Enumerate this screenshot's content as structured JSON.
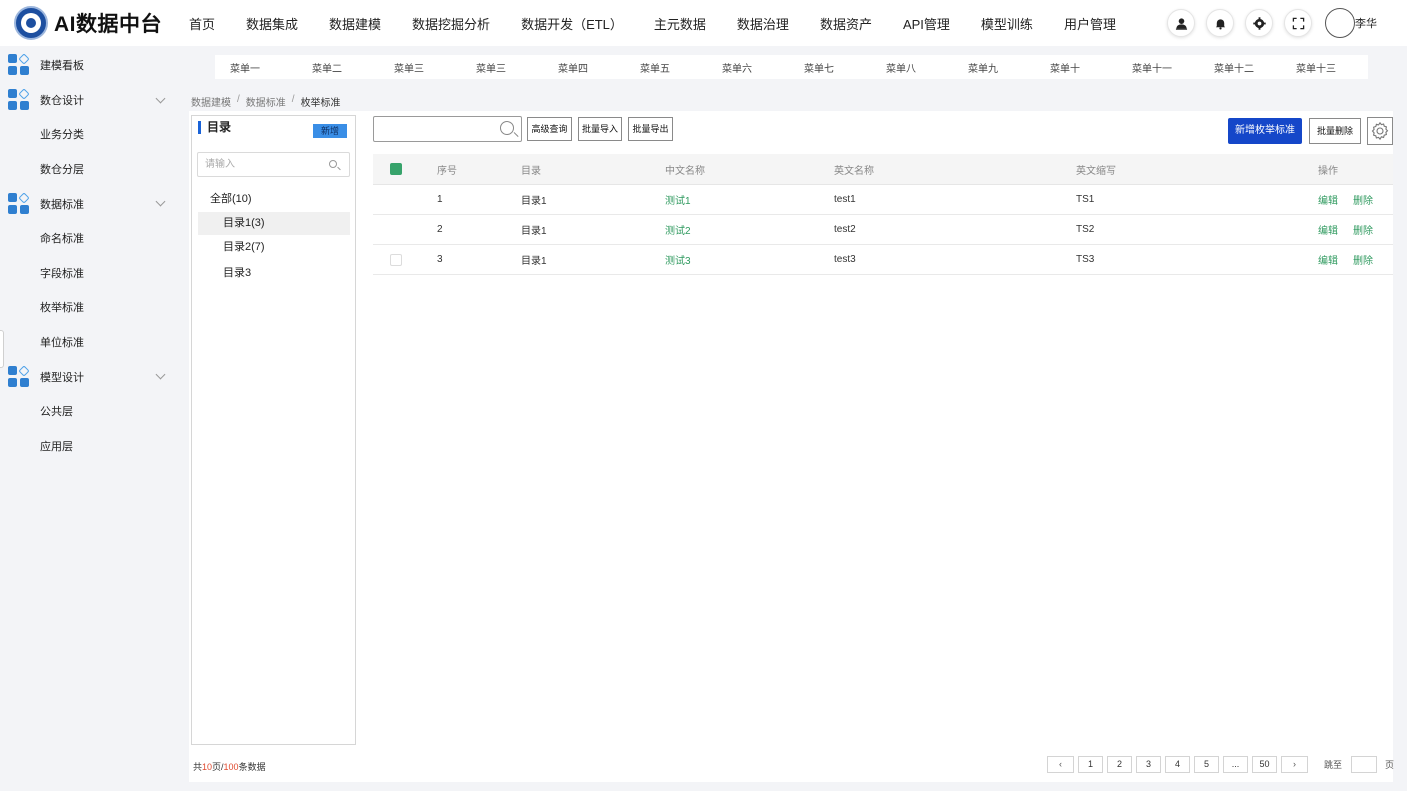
{
  "app": {
    "title": "AI数据中台"
  },
  "nav": [
    "首页",
    "数据集成",
    "数据建模",
    "数据挖掘分析",
    "数据开发（ETL）",
    "主元数据",
    "数据治理",
    "数据资产",
    "API管理",
    "模型训练",
    "用户管理"
  ],
  "user": {
    "name": "李华"
  },
  "icons": {
    "header": [
      "user-upload-icon",
      "bell-icon",
      "settings-icon",
      "fullscreen-icon"
    ],
    "sidebar_group": "grid-diamond-icon",
    "toolbar_settings": "gear-icon"
  },
  "sidebar": {
    "items": [
      {
        "label": "建模看板",
        "type": "group",
        "expandable": false
      },
      {
        "label": "数仓设计",
        "type": "group",
        "expandable": true
      },
      {
        "label": "业务分类",
        "type": "sub"
      },
      {
        "label": "数仓分层",
        "type": "sub"
      },
      {
        "label": "数据标准",
        "type": "group",
        "expandable": true
      },
      {
        "label": "命名标准",
        "type": "sub"
      },
      {
        "label": "字段标准",
        "type": "sub"
      },
      {
        "label": "枚举标准",
        "type": "sub"
      },
      {
        "label": "单位标准",
        "type": "sub"
      },
      {
        "label": "模型设计",
        "type": "group",
        "expandable": true
      },
      {
        "label": "公共层",
        "type": "sub"
      },
      {
        "label": "应用层",
        "type": "sub"
      }
    ]
  },
  "menus": [
    "菜单一",
    "菜单二",
    "菜单三",
    "菜单三",
    "菜单四",
    "菜单五",
    "菜单六",
    "菜单七",
    "菜单八",
    "菜单九",
    "菜单十",
    "菜单十一",
    "菜单十二",
    "菜单十三"
  ],
  "breadcrumb": [
    "数据建模",
    "数据标准",
    "枚举标准"
  ],
  "tree": {
    "title": "目录",
    "add_label": "新增",
    "search_placeholder": "请输入",
    "root": "全部(10)",
    "nodes": [
      "目录1(3)",
      "目录2(7)",
      "目录3"
    ],
    "active_index": 0
  },
  "toolbar": {
    "search_value": "",
    "advanced": "高级查询",
    "import": "批量导入",
    "export": "批量导出",
    "add_primary": "新增枚举标准",
    "batch_delete": "批量删除"
  },
  "table": {
    "headers": [
      "序号",
      "目录",
      "中文名称",
      "英文名称",
      "英文缩写",
      "操作"
    ],
    "header_checked": true,
    "rows": [
      {
        "index": "1",
        "dir": "目录1",
        "cn": "测试1",
        "en": "test1",
        "abbr": "TS1",
        "show_checkbox": false
      },
      {
        "index": "2",
        "dir": "目录1",
        "cn": "测试2",
        "en": "test2",
        "abbr": "TS2",
        "show_checkbox": false
      },
      {
        "index": "3",
        "dir": "目录1",
        "cn": "测试3",
        "en": "test3",
        "abbr": "TS3",
        "show_checkbox": true
      }
    ],
    "actions": [
      "编辑",
      "删除"
    ]
  },
  "pagination": {
    "total_prefix": "共",
    "pages": "10",
    "page_unit": "页/",
    "count": "100",
    "count_suffix": "条数据",
    "buttons": [
      "1",
      "2",
      "3",
      "4",
      "5",
      "...",
      "50"
    ],
    "prev": "‹",
    "next": "›",
    "jump_label": "跳至",
    "jump_value": "",
    "jump_unit": "页"
  },
  "colors": {
    "primary": "#1547c9",
    "link_green": "#2f9a5f",
    "accent_blue": "#3a8ee6",
    "highlight_red": "#e04a2f"
  }
}
